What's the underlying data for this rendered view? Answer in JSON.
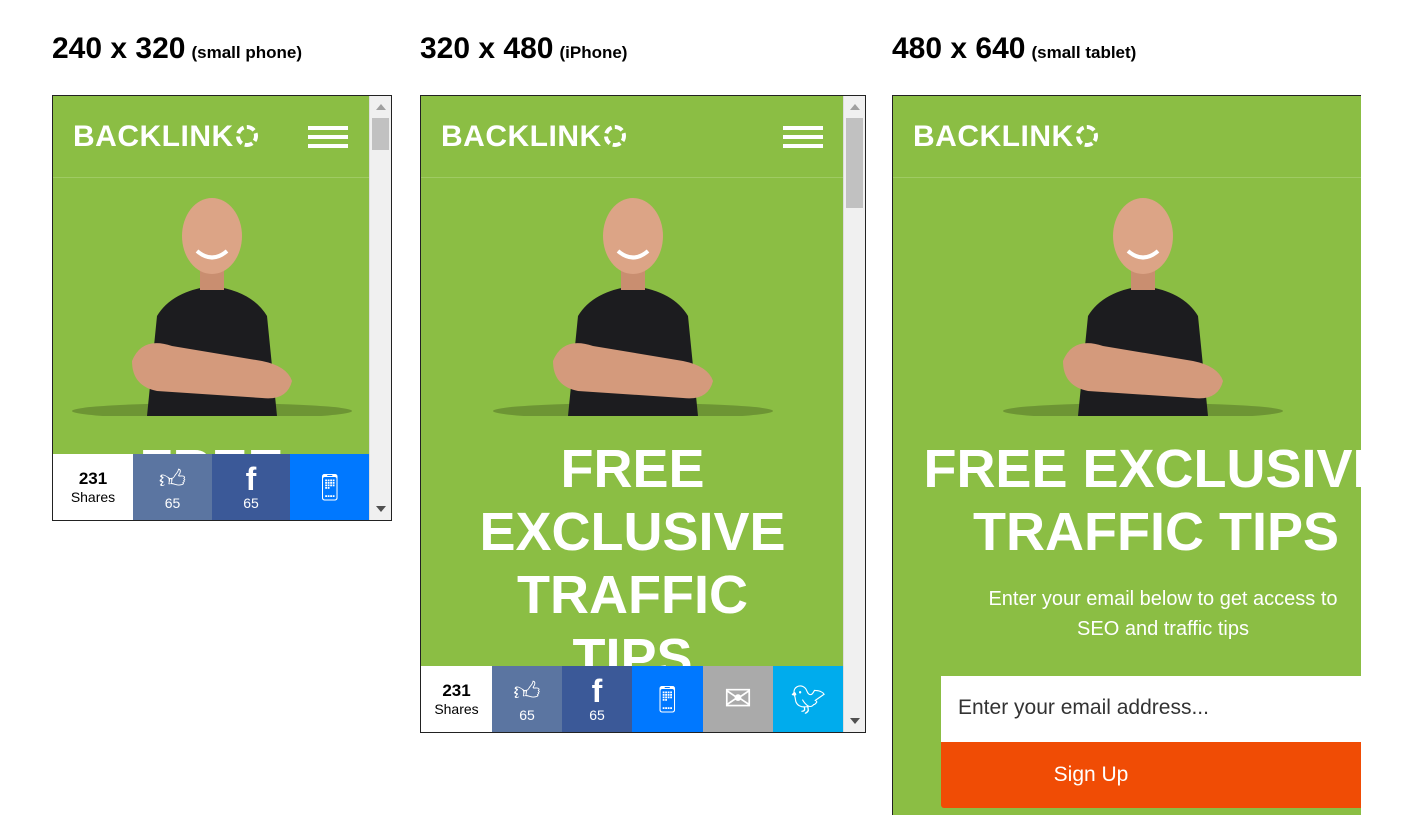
{
  "frames": [
    {
      "label": "240 x 320",
      "sublabel": "(small phone)",
      "title": [
        "FREE"
      ]
    },
    {
      "label": "320 x 480",
      "sublabel": "(iPhone)",
      "title": [
        "FREE",
        "EXCLUSIVE",
        "TRAFFIC",
        "TIPS"
      ]
    },
    {
      "label": "480 x 640",
      "sublabel": "(small tablet)",
      "title": [
        "FREE EXCLUSIVE",
        "TRAFFIC TIPS"
      ]
    }
  ],
  "logo": "BACKLINKO",
  "share": {
    "count": "231",
    "count_label": "Shares",
    "like_count": "65",
    "facebook_count": "65"
  },
  "subtitle": [
    "Enter your email below to get access to",
    "SEO and traffic tips"
  ],
  "email_placeholder": "Enter your email address...",
  "signup_label": "Sign Up",
  "colors": {
    "green": "#8bbe44",
    "like": "#5b75a1",
    "facebook": "#3b5998",
    "sms": "#0078ff",
    "email": "#aaaaaa",
    "twitter": "#00aced",
    "signup": "#f04c05"
  }
}
